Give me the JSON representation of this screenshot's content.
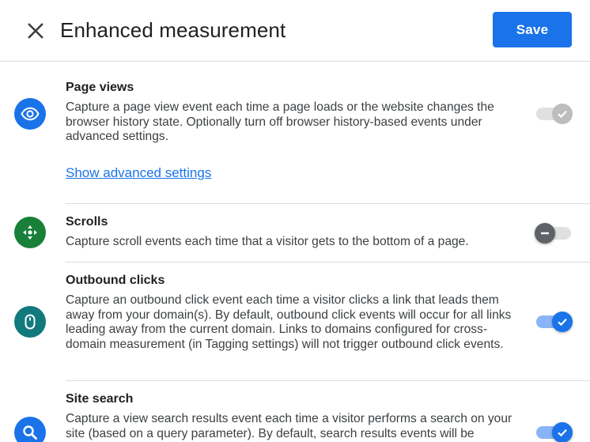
{
  "header": {
    "title": "Enhanced measurement",
    "save_label": "Save"
  },
  "rows": [
    {
      "icon": "eye-icon",
      "icon_color": "#1a73e8",
      "title": "Page views",
      "description": "Capture a page view event each time a page loads or the website changes the browser history state. Optionally turn off browser history-based events under advanced settings.",
      "link": "Show advanced settings",
      "toggle": "on-disabled"
    },
    {
      "icon": "scroll-arrows-icon",
      "icon_color": "#188038",
      "title": "Scrolls",
      "description": "Capture scroll events each time that a visitor gets to the bottom of a page.",
      "toggle": "off"
    },
    {
      "icon": "mouse-icon",
      "icon_color": "#12797c",
      "title": "Outbound clicks",
      "description": "Capture an outbound click event each time a visitor clicks a link that leads them away from your domain(s). By default, outbound click events will occur for all links leading away from the current domain. Links to domains configured for cross-domain measurement (in Tagging settings) will not trigger outbound click events.",
      "toggle": "on"
    },
    {
      "icon": "search-icon",
      "icon_color": "#1a73e8",
      "title": "Site search",
      "description": "Capture a view search results event each time a visitor performs a search on your site (based on a query parameter). By default, search results events will be",
      "toggle": "on"
    }
  ],
  "colors": {
    "accent": "#1a73e8",
    "divider": "#dadce0"
  }
}
